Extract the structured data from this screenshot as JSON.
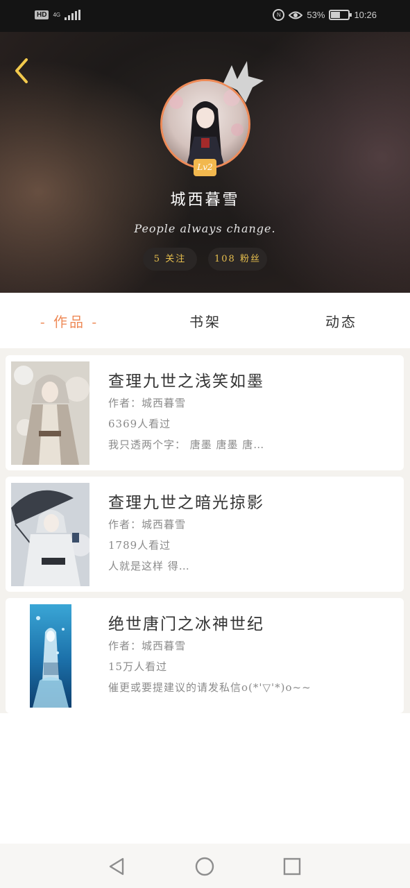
{
  "status_bar": {
    "hd": "HD",
    "network": "4G",
    "battery_percent": "53%",
    "time": "10:26",
    "battery_level": 0.53,
    "icons": [
      "hd-icon",
      "signal-icon",
      "nfc-icon",
      "eye-comfort-icon",
      "battery-icon"
    ]
  },
  "profile": {
    "level": "Lv2",
    "username": "城西暮雪",
    "signature": "People always change.",
    "following": "5 关注",
    "fans": "108 粉丝"
  },
  "tabs": [
    {
      "label": "- 作品 -",
      "active": true
    },
    {
      "label": "书架",
      "active": false
    },
    {
      "label": "动态",
      "active": false
    }
  ],
  "works": [
    {
      "title": "查理九世之浅笑如墨",
      "author": "作者：城西暮雪",
      "views": "6369人看过",
      "summary": "我只透两个字： 唐墨 唐墨 唐…"
    },
    {
      "title": "查理九世之暗光掠影",
      "author": "作者：城西暮雪",
      "views": "1789人看过",
      "summary": "人就是这样 得…"
    },
    {
      "title": "绝世唐门之冰神世纪",
      "author": "作者：城西暮雪",
      "views": "15万人看过",
      "summary": "催更或要提建议的请发私信o(*'▽'*)o~~"
    }
  ],
  "colors": {
    "accent": "#ee8a57",
    "badge": "#f2b84e",
    "pill_text": "#e8c04e",
    "back_arrow": "#f2c94c"
  }
}
